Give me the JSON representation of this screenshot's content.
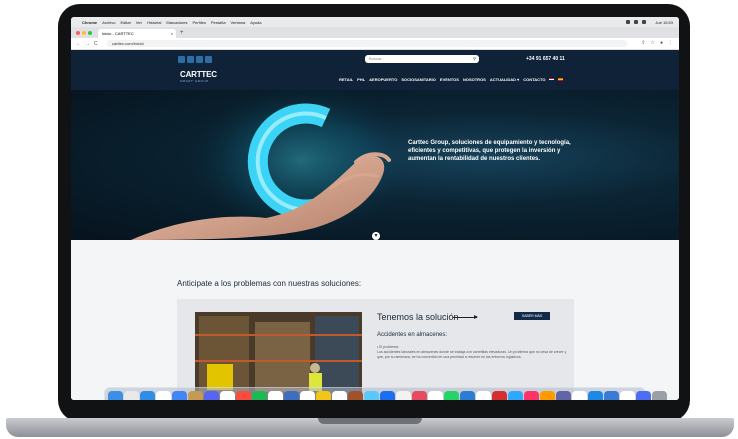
{
  "menubar": {
    "app": "Chrome",
    "items": [
      "Archivo",
      "Editar",
      "Ver",
      "Historial",
      "Marcadores",
      "Perfiles",
      "Pestaña",
      "Ventana",
      "Ayuda"
    ],
    "clock": "Jue 15:53"
  },
  "browser": {
    "tab_title": "Inicio - CARTTEC",
    "tab_close": "×",
    "new_tab": "+",
    "url": "carttec.com/inicio/",
    "nav_back": "←",
    "nav_forward": "→",
    "reload": "C"
  },
  "site": {
    "search_placeholder": "Buscar...",
    "search_icon": "search-icon",
    "phone": "+34 91 657 40 11",
    "logo_main": "CARTTEC",
    "logo_sub": "SMART GROUP",
    "nav": [
      "RETAIL",
      "PHL",
      "AEROPUERTO",
      "SOCIOSANITARIO",
      "EVENTOS",
      "NOSOTROS",
      "ACTUALIDAD ▾",
      "CONTACTO"
    ],
    "hero_text": "Carttec Group, soluciones de equipamiento y tecnología, eficientes y competitivas, que protegen la inversión y aumentan la rentabilidad de nuestros clientes.",
    "scroll_icon": "chevron-down-icon",
    "section_title": "Anticipate a los problemas con nuestras soluciones:",
    "card": {
      "heading": "Tenemos la solución",
      "button": "SABER MÁS",
      "subheading": "Accidentes en almacenes:",
      "bullet": "• El problema:",
      "body": "Los accidentes laborales en almacenes donde se trabaja con carretillas elevadoras. Un problema que no cesa de crecer y que, por su amenaza, se ha convertido en una prioridad a resolver en los entornos logísticos."
    }
  },
  "colors": {
    "header_bg": "#0f2238",
    "accent": "#2e6da4",
    "button": "#13294a"
  },
  "dock_colors": [
    "#3b8fe6",
    "#e9e9ec",
    "#2f8de4",
    "#ffffff",
    "#4285f4",
    "#c49a55",
    "#5865f2",
    "#ffffff",
    "#fb4d3d",
    "#1db954",
    "#ffffff",
    "#3d6ebf",
    "#ffffff",
    "#f3c515",
    "#ffffff",
    "#a0522d",
    "#5ac8fa",
    "#1d6df2",
    "#f2f2f2",
    "#e84a5f",
    "#ffffff",
    "#25d366",
    "#2b7cd3",
    "#ffffff",
    "#d4302f",
    "#31a8ff",
    "#ff3366",
    "#ff9a00",
    "#6264a7",
    "#ffffff",
    "#1e88e5",
    "#3a7bd5",
    "#ffffff",
    "#4c6ef5",
    "#9aa0a6"
  ]
}
